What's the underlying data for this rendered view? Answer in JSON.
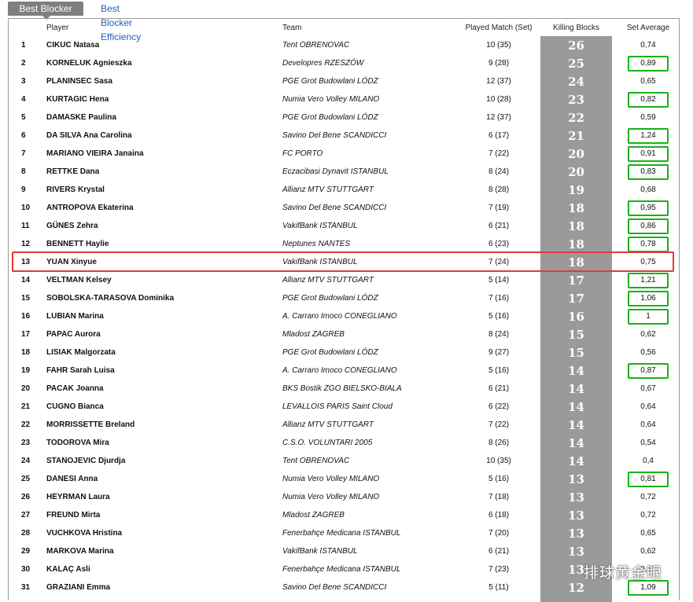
{
  "tabs": {
    "active": "Best Blocker",
    "other": "Best Blocker Efficiency"
  },
  "columns": {
    "player": "Player",
    "team": "Team",
    "played": "Played Match (Set)",
    "killing": "Killing Blocks",
    "avg": "Set Average"
  },
  "colors": {
    "highlight_box": "#e03a3a",
    "avg_box": "#19b219",
    "kill_column": "#9a9a9a"
  },
  "rows": [
    {
      "rank": "1",
      "player": "CIKUC Natasa",
      "team": "Tent OBRENOVAC",
      "played": "10 (35)",
      "kill": "26",
      "avg": "0,74",
      "boxed": false
    },
    {
      "rank": "2",
      "player": "KORNELUK Agnieszka",
      "team": "Developres RZESZÓW",
      "played": "9 (28)",
      "kill": "25",
      "avg": "0,89",
      "boxed": true
    },
    {
      "rank": "3",
      "player": "PLANINSEC Sasa",
      "team": "PGE Grot Budowlani LÓDZ",
      "played": "12 (37)",
      "kill": "24",
      "avg": "0,65",
      "boxed": false
    },
    {
      "rank": "4",
      "player": "KURTAGIC Hena",
      "team": "Numia Vero Volley MILANO",
      "played": "10 (28)",
      "kill": "23",
      "avg": "0,82",
      "boxed": true
    },
    {
      "rank": "5",
      "player": "DAMASKE Paulina",
      "team": "PGE Grot Budowlani LÓDZ",
      "played": "12 (37)",
      "kill": "22",
      "avg": "0,59",
      "boxed": false
    },
    {
      "rank": "6",
      "player": "DA SILVA Ana Carolina",
      "team": "Savino Del Bene SCANDICCI",
      "played": "6 (17)",
      "kill": "21",
      "avg": "1,24",
      "boxed": true
    },
    {
      "rank": "7",
      "player": "MARIANO VIEIRA Janaina",
      "team": "FC PORTO",
      "played": "7 (22)",
      "kill": "20",
      "avg": "0,91",
      "boxed": true
    },
    {
      "rank": "8",
      "player": "RETTKE Dana",
      "team": "Eczacibasi Dynavit ISTANBUL",
      "played": "8 (24)",
      "kill": "20",
      "avg": "0,83",
      "boxed": true
    },
    {
      "rank": "9",
      "player": "RIVERS Krystal",
      "team": "Allianz MTV STUTTGART",
      "played": "8 (28)",
      "kill": "19",
      "avg": "0,68",
      "boxed": false
    },
    {
      "rank": "10",
      "player": "ANTROPOVA Ekaterina",
      "team": "Savino Del Bene SCANDICCI",
      "played": "7 (19)",
      "kill": "18",
      "avg": "0,95",
      "boxed": true
    },
    {
      "rank": "11",
      "player": "GÜNES Zehra",
      "team": "VakifBank ISTANBUL",
      "played": "6 (21)",
      "kill": "18",
      "avg": "0,86",
      "boxed": true
    },
    {
      "rank": "12",
      "player": "BENNETT Haylie",
      "team": "Neptunes NANTES",
      "played": "6 (23)",
      "kill": "18",
      "avg": "0,78",
      "boxed": true
    },
    {
      "rank": "13",
      "player": "YUAN Xinyue",
      "team": "VakifBank ISTANBUL",
      "played": "7 (24)",
      "kill": "18",
      "avg": "0,75",
      "boxed": false
    },
    {
      "rank": "14",
      "player": "VELTMAN Kelsey",
      "team": "Allianz MTV STUTTGART",
      "played": "5 (14)",
      "kill": "17",
      "avg": "1,21",
      "boxed": true
    },
    {
      "rank": "15",
      "player": "SOBOLSKA-TARASOVA Dominika",
      "team": "PGE Grot Budowlani LÓDZ",
      "played": "7 (16)",
      "kill": "17",
      "avg": "1,06",
      "boxed": true
    },
    {
      "rank": "16",
      "player": "LUBIAN Marina",
      "team": "A. Carraro Imoco CONEGLIANO",
      "played": "5 (16)",
      "kill": "16",
      "avg": "1",
      "boxed": true
    },
    {
      "rank": "17",
      "player": "PAPAC Aurora",
      "team": "Mladost ZAGREB",
      "played": "8 (24)",
      "kill": "15",
      "avg": "0,62",
      "boxed": false
    },
    {
      "rank": "18",
      "player": "LISIAK Malgorzata",
      "team": "PGE Grot Budowlani LÓDZ",
      "played": "9 (27)",
      "kill": "15",
      "avg": "0,56",
      "boxed": false
    },
    {
      "rank": "19",
      "player": "FAHR Sarah Luisa",
      "team": "A. Carraro Imoco CONEGLIANO",
      "played": "5 (16)",
      "kill": "14",
      "avg": "0,87",
      "boxed": true
    },
    {
      "rank": "20",
      "player": "PACAK Joanna",
      "team": "BKS Bostik ZGO BIELSKO-BIALA",
      "played": "6 (21)",
      "kill": "14",
      "avg": "0,67",
      "boxed": false
    },
    {
      "rank": "21",
      "player": "CUGNO Bianca",
      "team": "LEVALLOIS PARIS Saint Cloud",
      "played": "6 (22)",
      "kill": "14",
      "avg": "0,64",
      "boxed": false
    },
    {
      "rank": "22",
      "player": "MORRISSETTE Breland",
      "team": "Allianz MTV STUTTGART",
      "played": "7 (22)",
      "kill": "14",
      "avg": "0,64",
      "boxed": false
    },
    {
      "rank": "23",
      "player": "TODOROVA Mira",
      "team": "C.S.O. VOLUNTARI 2005",
      "played": "8 (26)",
      "kill": "14",
      "avg": "0,54",
      "boxed": false
    },
    {
      "rank": "24",
      "player": "STANOJEVIC Djurdja",
      "team": "Tent OBRENOVAC",
      "played": "10 (35)",
      "kill": "14",
      "avg": "0,4",
      "boxed": false
    },
    {
      "rank": "25",
      "player": "DANESI Anna",
      "team": "Numia Vero Volley MILANO",
      "played": "5 (16)",
      "kill": "13",
      "avg": "0,81",
      "boxed": true
    },
    {
      "rank": "26",
      "player": "HEYRMAN Laura",
      "team": "Numia Vero Volley MILANO",
      "played": "7 (18)",
      "kill": "13",
      "avg": "0,72",
      "boxed": false
    },
    {
      "rank": "27",
      "player": "FREUND Mirta",
      "team": "Mladost ZAGREB",
      "played": "6 (18)",
      "kill": "13",
      "avg": "0,72",
      "boxed": false
    },
    {
      "rank": "28",
      "player": "VUCHKOVA Hristina",
      "team": "Fenerbahçe Medicana ISTANBUL",
      "played": "7 (20)",
      "kill": "13",
      "avg": "0,65",
      "boxed": false
    },
    {
      "rank": "29",
      "player": "MARKOVA Marina",
      "team": "VakifBank ISTANBUL",
      "played": "6 (21)",
      "kill": "13",
      "avg": "0,62",
      "boxed": false
    },
    {
      "rank": "30",
      "player": "KALAÇ Asli",
      "team": "Fenerbahçe Medicana ISTANBUL",
      "played": "7 (23)",
      "kill": "13",
      "avg": "0,57",
      "boxed": false
    },
    {
      "rank": "31",
      "player": "GRAZIANI Emma",
      "team": "Savino Del Bene SCANDICCI",
      "played": "5 (11)",
      "kill": "12",
      "avg": "1,09",
      "boxed": true
    }
  ],
  "watermark": "排球黄金眼"
}
